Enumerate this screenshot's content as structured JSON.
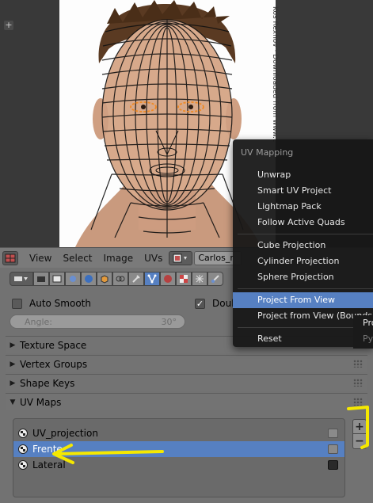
{
  "viewport": {
    "watermark_text": "Kos Rexhov · Downloaded from www.t"
  },
  "uv_header": {
    "menus": [
      "View",
      "Select",
      "Image",
      "UVs"
    ],
    "image_name": "Carlos_r"
  },
  "properties": {
    "auto_smooth_label": "Auto Smooth",
    "double_sided_label": "Doub",
    "angle_label": "Angle:",
    "angle_value": "30°",
    "sections": [
      {
        "label": "Texture Space",
        "expanded": false
      },
      {
        "label": "Vertex Groups",
        "expanded": false
      },
      {
        "label": "Shape Keys",
        "expanded": false
      },
      {
        "label": "UV Maps",
        "expanded": true
      }
    ],
    "uv_maps": [
      {
        "name": "UV_projection",
        "selected": false
      },
      {
        "name": "Frente",
        "selected": true
      },
      {
        "name": "Lateral",
        "selected": false
      }
    ],
    "add_symbol": "+",
    "remove_symbol": "−"
  },
  "uv_menu": {
    "title": "UV Mapping",
    "items": [
      {
        "label": "Unwrap",
        "highlighted": false
      },
      {
        "label": "Smart UV Project",
        "highlighted": false
      },
      {
        "label": "Lightmap Pack",
        "highlighted": false
      },
      {
        "label": "Follow Active Quads",
        "highlighted": false
      },
      {
        "label": "Cube Projection",
        "highlighted": false
      },
      {
        "label": "Cylinder Projection",
        "highlighted": false
      },
      {
        "label": "Sphere Projection",
        "highlighted": false
      },
      {
        "label": "Project From View",
        "highlighted": true
      },
      {
        "label": "Project from View (Bounds)",
        "highlighted": false
      },
      {
        "label": "Reset",
        "highlighted": false
      }
    ],
    "submenu": [
      "Pro",
      "Py"
    ]
  },
  "colors": {
    "accent_blue": "#5680c2",
    "annotation_yellow": "#f5e800",
    "mesh_wire": "#111111",
    "selected_edges": "#f08a24"
  }
}
